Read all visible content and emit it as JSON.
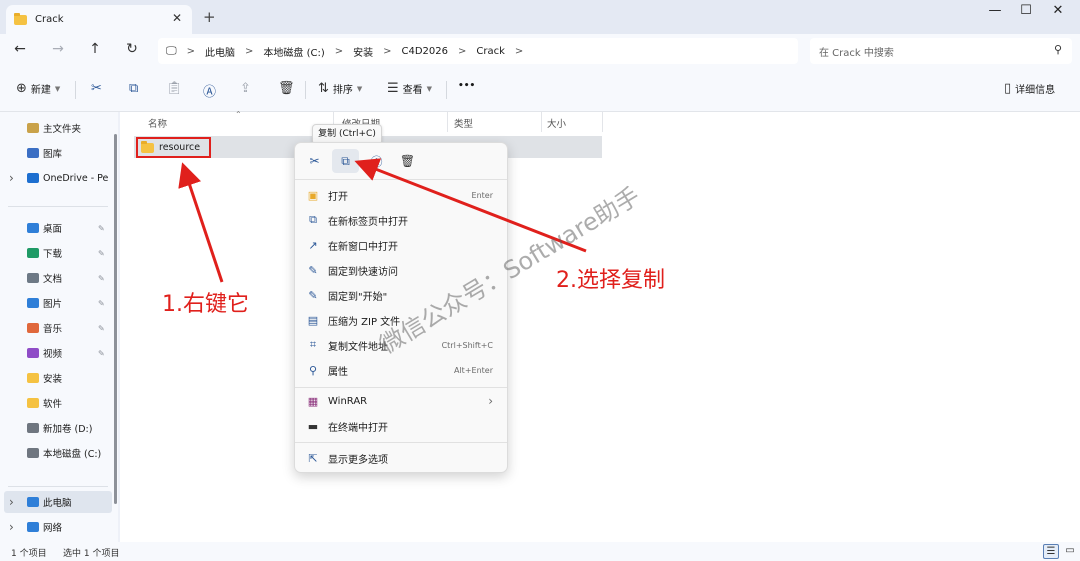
{
  "window": {
    "tab_title": "Crack",
    "tab_close": "✕",
    "new_tab": "+",
    "minimize": "—",
    "maximize": "☐",
    "close": "✕"
  },
  "nav": {
    "back": "←",
    "forward": "→",
    "up": "↑",
    "refresh": "↻"
  },
  "breadcrumb": [
    "此电脑",
    "本地磁盘 (C:)",
    "安装",
    "C4D2026",
    "Crack"
  ],
  "breadcrumb_sep": ">",
  "search": {
    "placeholder": "在 Crack 中搜索"
  },
  "toolbar": {
    "new_label": "新建",
    "sort_label": "排序",
    "view_label": "查看",
    "more_label": "•••",
    "details_label": "详细信息"
  },
  "sidebar": {
    "items": [
      {
        "label": "主文件夹",
        "icon": "home-icon",
        "color": "#c9a24a",
        "pinned": false,
        "chevron": false
      },
      {
        "label": "图库",
        "icon": "gallery-icon",
        "color": "#3b6fc4",
        "pinned": false,
        "chevron": false
      },
      {
        "label": "OneDrive - Per",
        "icon": "cloud-icon",
        "color": "#1d6fd0",
        "pinned": false,
        "chevron": true
      },
      {
        "label": "桌面",
        "icon": "desktop-icon",
        "color": "#2f7fd8",
        "pinned": true,
        "chevron": false
      },
      {
        "label": "下载",
        "icon": "download-icon",
        "color": "#1f9a66",
        "pinned": true,
        "chevron": false
      },
      {
        "label": "文档",
        "icon": "documents-icon",
        "color": "#6d7986",
        "pinned": true,
        "chevron": false
      },
      {
        "label": "图片",
        "icon": "pictures-icon",
        "color": "#2f7fd8",
        "pinned": true,
        "chevron": false
      },
      {
        "label": "音乐",
        "icon": "music-icon",
        "color": "#e0683c",
        "pinned": true,
        "chevron": false
      },
      {
        "label": "视频",
        "icon": "videos-icon",
        "color": "#8f4cc7",
        "pinned": true,
        "chevron": false
      },
      {
        "label": "安装",
        "icon": "folder-icon",
        "color": "#f5c242",
        "pinned": false,
        "chevron": false
      },
      {
        "label": "软件",
        "icon": "folder-icon",
        "color": "#f5c242",
        "pinned": false,
        "chevron": false
      },
      {
        "label": "新加卷 (D:)",
        "icon": "drive-icon",
        "color": "#6f7680",
        "pinned": false,
        "chevron": false
      },
      {
        "label": "本地磁盘 (C:)",
        "icon": "drive-icon",
        "color": "#6f7680",
        "pinned": false,
        "chevron": false
      },
      {
        "label": "此电脑",
        "icon": "computer-icon",
        "color": "#2f7fd8",
        "pinned": false,
        "chevron": true
      },
      {
        "label": "网络",
        "icon": "network-icon",
        "color": "#2f7fd8",
        "pinned": false,
        "chevron": true
      }
    ]
  },
  "columns": {
    "name": "名称",
    "modified": "修改日期",
    "type": "类型",
    "size": "大小"
  },
  "files": [
    {
      "name": "resource",
      "icon": "folder-icon"
    }
  ],
  "tooltip": "复制 (Ctrl+C)",
  "context_menu": {
    "top_icons": [
      "cut-icon",
      "copy-icon",
      "rename-icon",
      "delete-icon"
    ],
    "items": [
      {
        "label": "打开",
        "shortcut": "Enter",
        "icon": "folder-open-icon",
        "glyph": "▣"
      },
      {
        "label": "在新标签页中打开",
        "shortcut": "",
        "icon": "new-tab-icon",
        "glyph": "⧉"
      },
      {
        "label": "在新窗口中打开",
        "shortcut": "",
        "icon": "new-window-icon",
        "glyph": "↗"
      },
      {
        "label": "固定到快速访问",
        "shortcut": "",
        "icon": "pin-icon",
        "glyph": "✎"
      },
      {
        "label": "固定到\"开始\"",
        "shortcut": "",
        "icon": "pin-start-icon",
        "glyph": "✎"
      },
      {
        "label": "压缩为 ZIP 文件",
        "shortcut": "",
        "icon": "zip-icon",
        "glyph": "▤"
      },
      {
        "label": "复制文件地址",
        "shortcut": "Ctrl+Shift+C",
        "icon": "copy-path-icon",
        "glyph": "⌗"
      },
      {
        "label": "属性",
        "shortcut": "Alt+Enter",
        "icon": "properties-icon",
        "glyph": "⚲"
      }
    ],
    "winrar": {
      "label": "WinRAR",
      "arrow": "›",
      "glyph": "▦"
    },
    "terminal": {
      "label": "在终端中打开",
      "glyph": "▬"
    },
    "more": {
      "label": "显示更多选项",
      "glyph": "⇱"
    }
  },
  "annotations": {
    "step1": "1.右键它",
    "step2": "2.选择复制",
    "watermark": "微信公众号：Software助手",
    "color": "#e0201c"
  },
  "status": {
    "count": "1 个项目",
    "selected": "选中 1 个项目"
  }
}
